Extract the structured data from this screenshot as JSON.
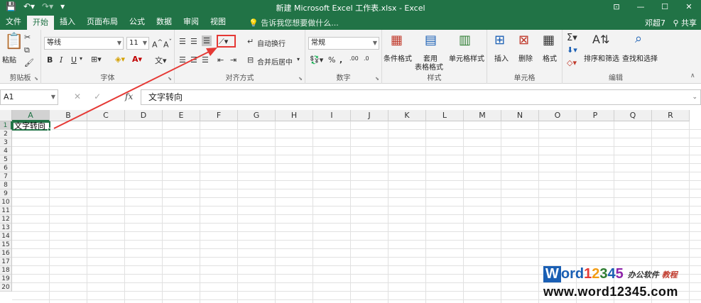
{
  "titlebar": {
    "title": "新建 Microsoft Excel 工作表.xlsx - Excel",
    "ribbon_display_glyph": "⊡",
    "minimize_glyph": "—",
    "restore_glyph": "☐",
    "close_glyph": "✕"
  },
  "tabs": [
    {
      "label": "文件"
    },
    {
      "label": "开始"
    },
    {
      "label": "插入"
    },
    {
      "label": "页面布局"
    },
    {
      "label": "公式"
    },
    {
      "label": "数据"
    },
    {
      "label": "审阅"
    },
    {
      "label": "视图"
    }
  ],
  "tellme": {
    "text": "告诉我您想要做什么..."
  },
  "user": {
    "name": "邓超7",
    "share": "共享"
  },
  "ribbon": {
    "clipboard": {
      "label": "剪贴板",
      "paste": "粘贴"
    },
    "font": {
      "label": "字体",
      "font_name": "等线",
      "font_size": "11",
      "bold": "B",
      "italic": "I",
      "underline": "U"
    },
    "alignment": {
      "label": "对齐方式",
      "wrap": "自动换行",
      "merge": "合并后居中"
    },
    "number": {
      "label": "数字",
      "format": "常规",
      "percent": "%",
      "comma": ","
    },
    "styles": {
      "label": "样式",
      "conditional": "条件格式",
      "table_line1": "套用",
      "table_line2": "表格格式",
      "cell_styles": "单元格样式"
    },
    "cells": {
      "label": "单元格",
      "insert": "插入",
      "delete": "删除",
      "format": "格式"
    },
    "editing": {
      "label": "编辑",
      "sort": "排序和筛选",
      "find": "查找和选择"
    }
  },
  "formula_bar": {
    "name_box": "A1",
    "fx": "fx",
    "content": "文字转向"
  },
  "grid": {
    "columns": [
      "A",
      "B",
      "C",
      "D",
      "E",
      "F",
      "G",
      "H",
      "I",
      "J",
      "K",
      "L",
      "M",
      "N",
      "O",
      "P",
      "Q",
      "R"
    ],
    "rows": [
      "1",
      "2",
      "3",
      "4",
      "5",
      "6",
      "7",
      "8",
      "9",
      "10",
      "11",
      "12",
      "13",
      "14",
      "15",
      "16",
      "17",
      "18",
      "19",
      "20"
    ],
    "selected_cell": "A1",
    "a1_value": "文字转向"
  },
  "watermark": {
    "w": "W",
    "ord": "ord",
    "n1": "1",
    "n2": "2",
    "n3": "3",
    "n4": "4",
    "n5": "5",
    "cn1": "办公软件",
    "cn2": "教程",
    "url": "www.word12345.com"
  },
  "colors": {
    "excel_green": "#217346",
    "annotation_red": "#e53935"
  }
}
